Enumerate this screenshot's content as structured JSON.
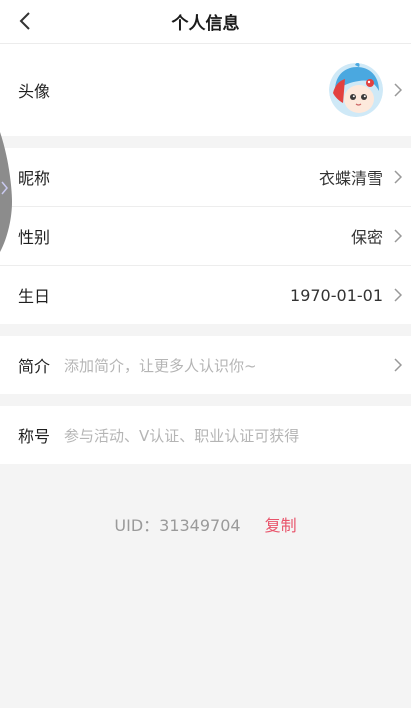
{
  "header": {
    "title": "个人信息"
  },
  "rows": {
    "avatar": {
      "label": "头像"
    },
    "nickname": {
      "label": "昵称",
      "value": "衣蝶清雪"
    },
    "gender": {
      "label": "性别",
      "value": "保密"
    },
    "birthday": {
      "label": "生日",
      "value": "1970-01-01"
    },
    "bio": {
      "label": "简介",
      "placeholder": "添加简介，让更多人认识你~"
    },
    "title_badge": {
      "label": "称号",
      "placeholder": "参与活动、V认证、职业认证可获得"
    }
  },
  "footer": {
    "uid_text": "UID：31349704",
    "copy_label": "复制"
  },
  "colors": {
    "accent": "#e8546b",
    "background": "#f4f4f4",
    "placeholder": "#b5b5b5"
  },
  "icons": [
    "back-arrow-icon",
    "chevron-right-icon"
  ]
}
